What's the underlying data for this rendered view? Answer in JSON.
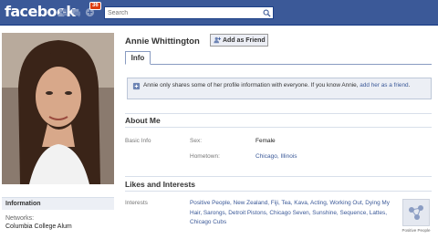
{
  "topbar": {
    "logo": "facebook",
    "notification_count": "36",
    "search_placeholder": "Search",
    "icons": [
      "friends-icon",
      "messages-icon",
      "notifications-icon",
      "search-icon"
    ],
    "brand_color": "#3b5998"
  },
  "profile": {
    "name": "Annie Whittington",
    "add_friend_label": "Add as Friend",
    "tab_info": "Info",
    "notice_text_before": "Annie only shares some of her profile information with everyone. If you know Annie, ",
    "notice_link": "add her as a friend",
    "notice_text_after": "."
  },
  "about": {
    "title": "About Me",
    "basic_info_label": "Basic Info",
    "sex_label": "Sex:",
    "sex_value": "Female",
    "hometown_label": "Hometown:",
    "hometown_value": "Chicago, Illinois"
  },
  "likes": {
    "title": "Likes and Interests",
    "interests_label": "Interests",
    "interests_value": "Positive People, New Zealand, Fiji, Tea, Kava, Acting, Working Out, Dying My Hair, Sarongs, Detroit Pistons, Chicago Seven, Sunshine, Sequence, Lattes, Chicago Cubs",
    "page_caption": "Positive People"
  },
  "sidebar": {
    "info_header": "Information",
    "networks_label": "Networks:",
    "networks_value": "Columbia College Alum"
  }
}
